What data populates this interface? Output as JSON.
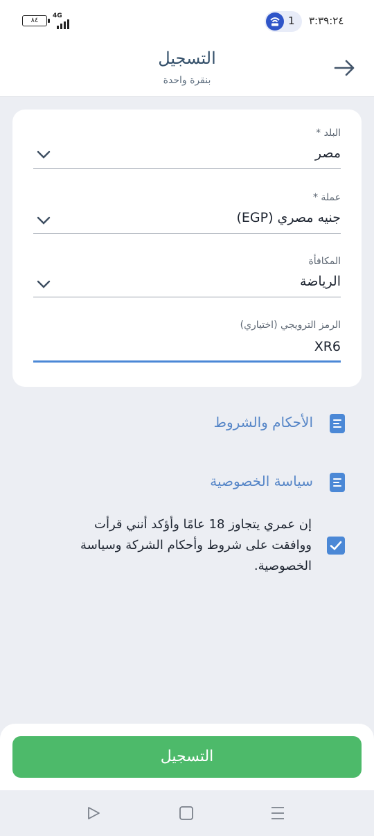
{
  "status_bar": {
    "battery": "٨٤",
    "network": "4G",
    "hotspot_count": "1",
    "time": "٣:٣٩:٢٤"
  },
  "header": {
    "title": "التسجيل",
    "subtitle": "بنقرة واحدة",
    "back_icon": "arrow-right-icon"
  },
  "form": {
    "fields": [
      {
        "label": "البلد *",
        "value": "مصر"
      },
      {
        "label": "عملة *",
        "value": "جنيه مصري (EGP)"
      },
      {
        "label": "المكافأة",
        "value": "الرياضة"
      },
      {
        "label": "الرمز الترويجي (اختياري)",
        "value": "XR6"
      }
    ]
  },
  "links": {
    "terms": "الأحكام والشروط",
    "privacy": "سياسة الخصوصية"
  },
  "agreement": {
    "checked": true,
    "text": "إن عمري يتجاوز 18 عامًا وأؤكد أنني قرأت ووافقت على شروط وأحكام الشركة وسياسة الخصوصية."
  },
  "register_button": "التسجيل",
  "colors": {
    "accent": "#4b88d6",
    "primary_button": "#4dba6a",
    "title": "#34506a"
  }
}
